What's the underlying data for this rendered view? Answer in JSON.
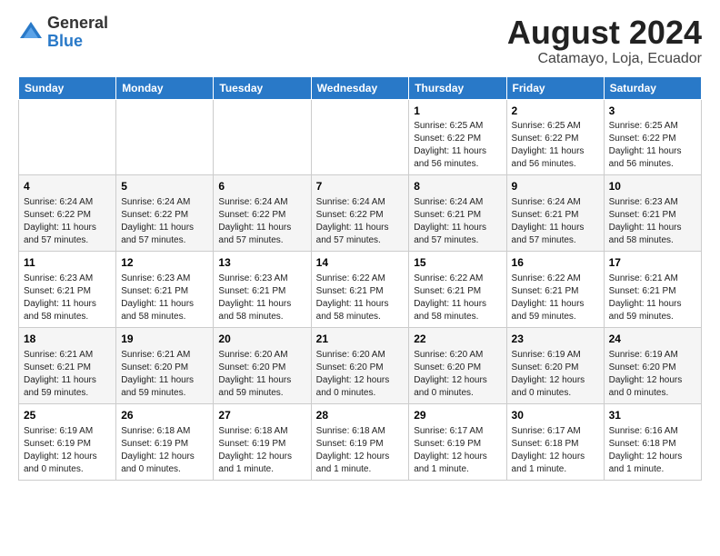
{
  "logo": {
    "general": "General",
    "blue": "Blue"
  },
  "title": "August 2024",
  "subtitle": "Catamayo, Loja, Ecuador",
  "weekdays": [
    "Sunday",
    "Monday",
    "Tuesday",
    "Wednesday",
    "Thursday",
    "Friday",
    "Saturday"
  ],
  "weeks": [
    [
      {
        "day": "",
        "info": ""
      },
      {
        "day": "",
        "info": ""
      },
      {
        "day": "",
        "info": ""
      },
      {
        "day": "",
        "info": ""
      },
      {
        "day": "1",
        "info": "Sunrise: 6:25 AM\nSunset: 6:22 PM\nDaylight: 11 hours and 56 minutes."
      },
      {
        "day": "2",
        "info": "Sunrise: 6:25 AM\nSunset: 6:22 PM\nDaylight: 11 hours and 56 minutes."
      },
      {
        "day": "3",
        "info": "Sunrise: 6:25 AM\nSunset: 6:22 PM\nDaylight: 11 hours and 56 minutes."
      }
    ],
    [
      {
        "day": "4",
        "info": "Sunrise: 6:24 AM\nSunset: 6:22 PM\nDaylight: 11 hours and 57 minutes."
      },
      {
        "day": "5",
        "info": "Sunrise: 6:24 AM\nSunset: 6:22 PM\nDaylight: 11 hours and 57 minutes."
      },
      {
        "day": "6",
        "info": "Sunrise: 6:24 AM\nSunset: 6:22 PM\nDaylight: 11 hours and 57 minutes."
      },
      {
        "day": "7",
        "info": "Sunrise: 6:24 AM\nSunset: 6:22 PM\nDaylight: 11 hours and 57 minutes."
      },
      {
        "day": "8",
        "info": "Sunrise: 6:24 AM\nSunset: 6:21 PM\nDaylight: 11 hours and 57 minutes."
      },
      {
        "day": "9",
        "info": "Sunrise: 6:24 AM\nSunset: 6:21 PM\nDaylight: 11 hours and 57 minutes."
      },
      {
        "day": "10",
        "info": "Sunrise: 6:23 AM\nSunset: 6:21 PM\nDaylight: 11 hours and 58 minutes."
      }
    ],
    [
      {
        "day": "11",
        "info": "Sunrise: 6:23 AM\nSunset: 6:21 PM\nDaylight: 11 hours and 58 minutes."
      },
      {
        "day": "12",
        "info": "Sunrise: 6:23 AM\nSunset: 6:21 PM\nDaylight: 11 hours and 58 minutes."
      },
      {
        "day": "13",
        "info": "Sunrise: 6:23 AM\nSunset: 6:21 PM\nDaylight: 11 hours and 58 minutes."
      },
      {
        "day": "14",
        "info": "Sunrise: 6:22 AM\nSunset: 6:21 PM\nDaylight: 11 hours and 58 minutes."
      },
      {
        "day": "15",
        "info": "Sunrise: 6:22 AM\nSunset: 6:21 PM\nDaylight: 11 hours and 58 minutes."
      },
      {
        "day": "16",
        "info": "Sunrise: 6:22 AM\nSunset: 6:21 PM\nDaylight: 11 hours and 59 minutes."
      },
      {
        "day": "17",
        "info": "Sunrise: 6:21 AM\nSunset: 6:21 PM\nDaylight: 11 hours and 59 minutes."
      }
    ],
    [
      {
        "day": "18",
        "info": "Sunrise: 6:21 AM\nSunset: 6:21 PM\nDaylight: 11 hours and 59 minutes."
      },
      {
        "day": "19",
        "info": "Sunrise: 6:21 AM\nSunset: 6:20 PM\nDaylight: 11 hours and 59 minutes."
      },
      {
        "day": "20",
        "info": "Sunrise: 6:20 AM\nSunset: 6:20 PM\nDaylight: 11 hours and 59 minutes."
      },
      {
        "day": "21",
        "info": "Sunrise: 6:20 AM\nSunset: 6:20 PM\nDaylight: 12 hours and 0 minutes."
      },
      {
        "day": "22",
        "info": "Sunrise: 6:20 AM\nSunset: 6:20 PM\nDaylight: 12 hours and 0 minutes."
      },
      {
        "day": "23",
        "info": "Sunrise: 6:19 AM\nSunset: 6:20 PM\nDaylight: 12 hours and 0 minutes."
      },
      {
        "day": "24",
        "info": "Sunrise: 6:19 AM\nSunset: 6:20 PM\nDaylight: 12 hours and 0 minutes."
      }
    ],
    [
      {
        "day": "25",
        "info": "Sunrise: 6:19 AM\nSunset: 6:19 PM\nDaylight: 12 hours and 0 minutes."
      },
      {
        "day": "26",
        "info": "Sunrise: 6:18 AM\nSunset: 6:19 PM\nDaylight: 12 hours and 0 minutes."
      },
      {
        "day": "27",
        "info": "Sunrise: 6:18 AM\nSunset: 6:19 PM\nDaylight: 12 hours and 1 minute."
      },
      {
        "day": "28",
        "info": "Sunrise: 6:18 AM\nSunset: 6:19 PM\nDaylight: 12 hours and 1 minute."
      },
      {
        "day": "29",
        "info": "Sunrise: 6:17 AM\nSunset: 6:19 PM\nDaylight: 12 hours and 1 minute."
      },
      {
        "day": "30",
        "info": "Sunrise: 6:17 AM\nSunset: 6:18 PM\nDaylight: 12 hours and 1 minute."
      },
      {
        "day": "31",
        "info": "Sunrise: 6:16 AM\nSunset: 6:18 PM\nDaylight: 12 hours and 1 minute."
      }
    ]
  ]
}
